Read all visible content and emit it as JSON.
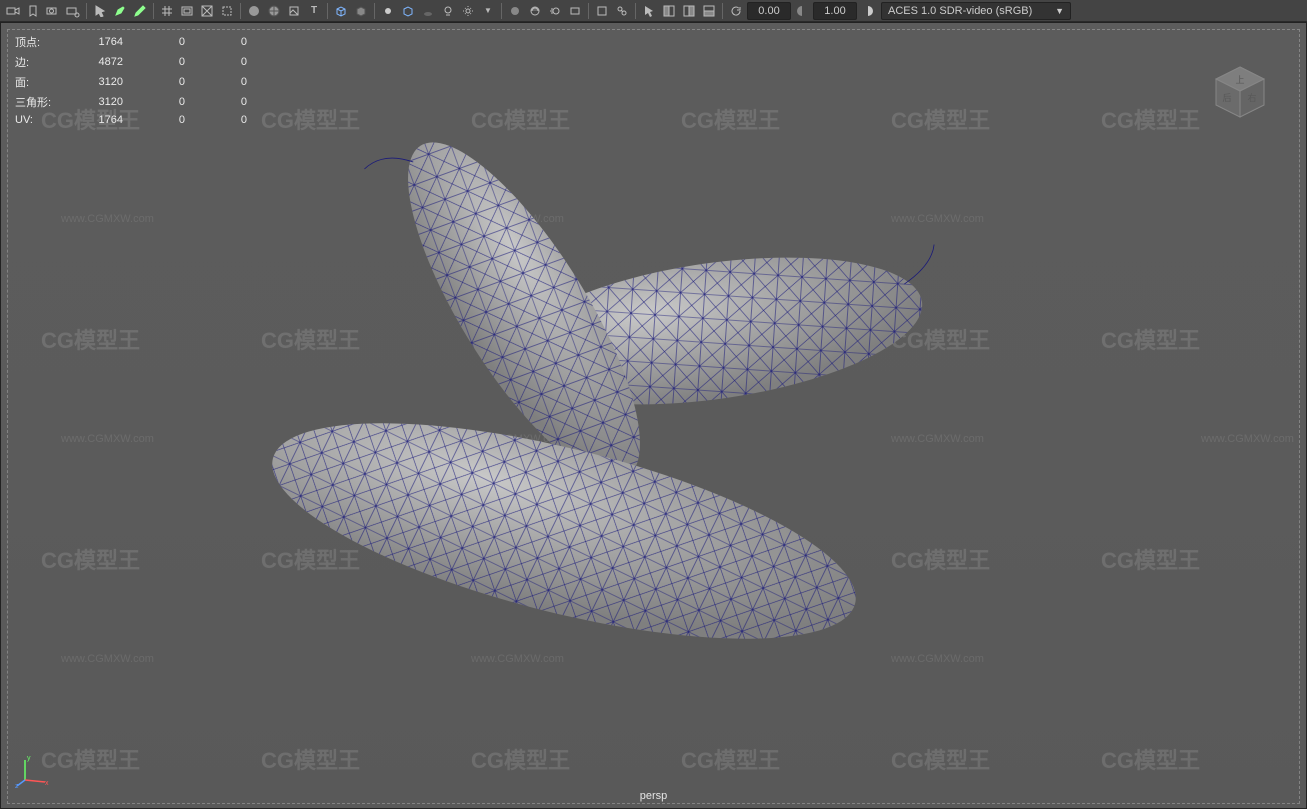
{
  "toolbar": {
    "numeric1": "0.00",
    "numeric2": "1.00",
    "colorspace": "ACES 1.0 SDR-video (sRGB)"
  },
  "hud": {
    "rows": [
      {
        "label": "顶点:",
        "c0": "1764",
        "c1": "0",
        "c2": "0"
      },
      {
        "label": "边:",
        "c0": "4872",
        "c1": "0",
        "c2": "0"
      },
      {
        "label": "面:",
        "c0": "3120",
        "c1": "0",
        "c2": "0"
      },
      {
        "label": "三角形:",
        "c0": "3120",
        "c1": "0",
        "c2": "0"
      },
      {
        "label": "UV:",
        "c0": "1764",
        "c1": "0",
        "c2": "0"
      }
    ]
  },
  "viewport": {
    "camera_label": "persp",
    "axes": {
      "x": "x",
      "y": "y",
      "z": "z"
    }
  },
  "watermark": {
    "brand": "CG模型王",
    "url": "www.CGMXW.com"
  }
}
